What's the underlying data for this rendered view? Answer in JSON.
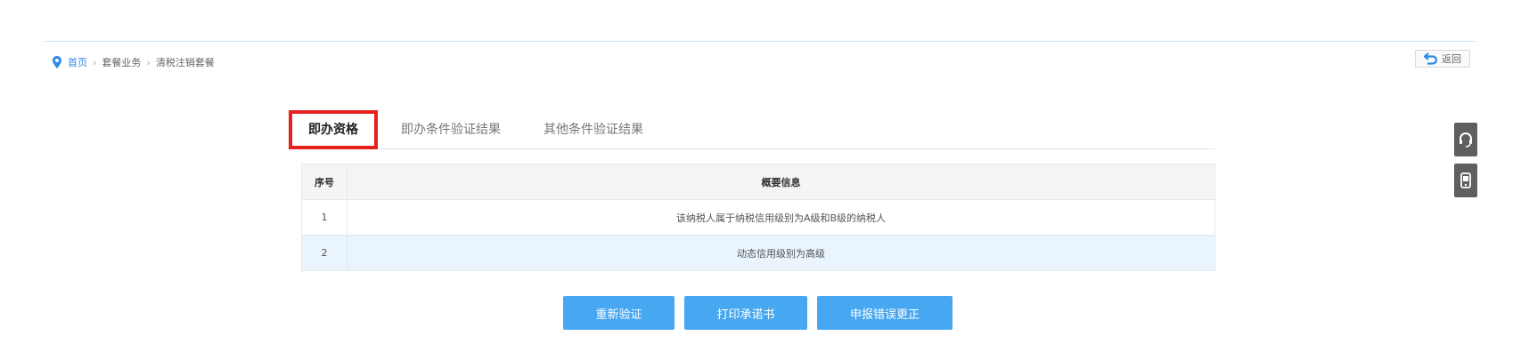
{
  "breadcrumb": {
    "items": [
      "首页",
      "套餐业务",
      "清税注销套餐"
    ]
  },
  "back_button": {
    "label": "返回"
  },
  "tabs": [
    {
      "label": "即办资格",
      "active": true
    },
    {
      "label": "即办条件验证结果",
      "active": false
    },
    {
      "label": "其他条件验证结果",
      "active": false
    }
  ],
  "table": {
    "headers": [
      "序号",
      "概要信息"
    ],
    "rows": [
      {
        "seq": "1",
        "info": "该纳税人属于纳税信用级别为A级和B级的纳税人"
      },
      {
        "seq": "2",
        "info": "动态信用级别为高级"
      }
    ]
  },
  "actions": {
    "reverify": "重新验证",
    "print_commitment": "打印承诺书",
    "declare_correction": "申报错误更正"
  },
  "icons": {
    "breadcrumb": "location-pin-icon",
    "back": "return-arrow-icon",
    "side_tool_1": "headset-icon",
    "side_tool_2": "phone-icon"
  },
  "colors": {
    "accent": "#47a7f0",
    "active_tab_border": "#e8201e",
    "link": "#2e8ae6",
    "row_highlight": "#e9f4fd",
    "side_tool": "#5f5f5f"
  }
}
